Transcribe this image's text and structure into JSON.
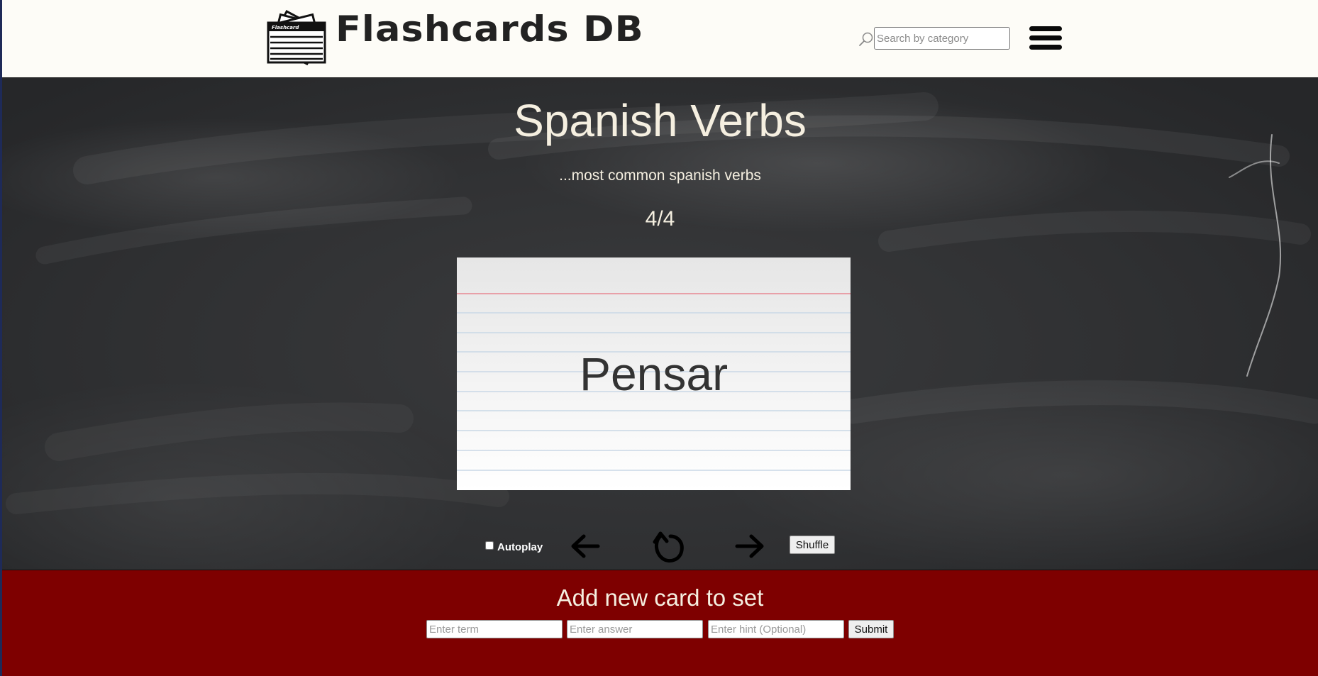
{
  "header": {
    "brand": "Flashcards DB",
    "logo_card_text": "Flashcard",
    "search": {
      "placeholder": "Search by category",
      "value": ""
    }
  },
  "set": {
    "title": "Spanish Verbs",
    "description": "...most common spanish verbs",
    "counter": "4/4",
    "current_card": {
      "term": "Pensar"
    }
  },
  "controls": {
    "autoplay_label": "Autoplay",
    "autoplay_checked": false,
    "shuffle_label": "Shuffle"
  },
  "add_card": {
    "title": "Add new card to set",
    "term_placeholder": "Enter term",
    "answer_placeholder": "Enter answer",
    "hint_placeholder": "Enter hint (Optional)",
    "submit_label": "Submit"
  },
  "colors": {
    "header_bg": "#fdfcf7",
    "footer_bg": "#7e0000",
    "chalk_text": "#f5efe0",
    "card_margin_line": "#e8a0a8",
    "card_rule_line": "#c9d8e6"
  }
}
